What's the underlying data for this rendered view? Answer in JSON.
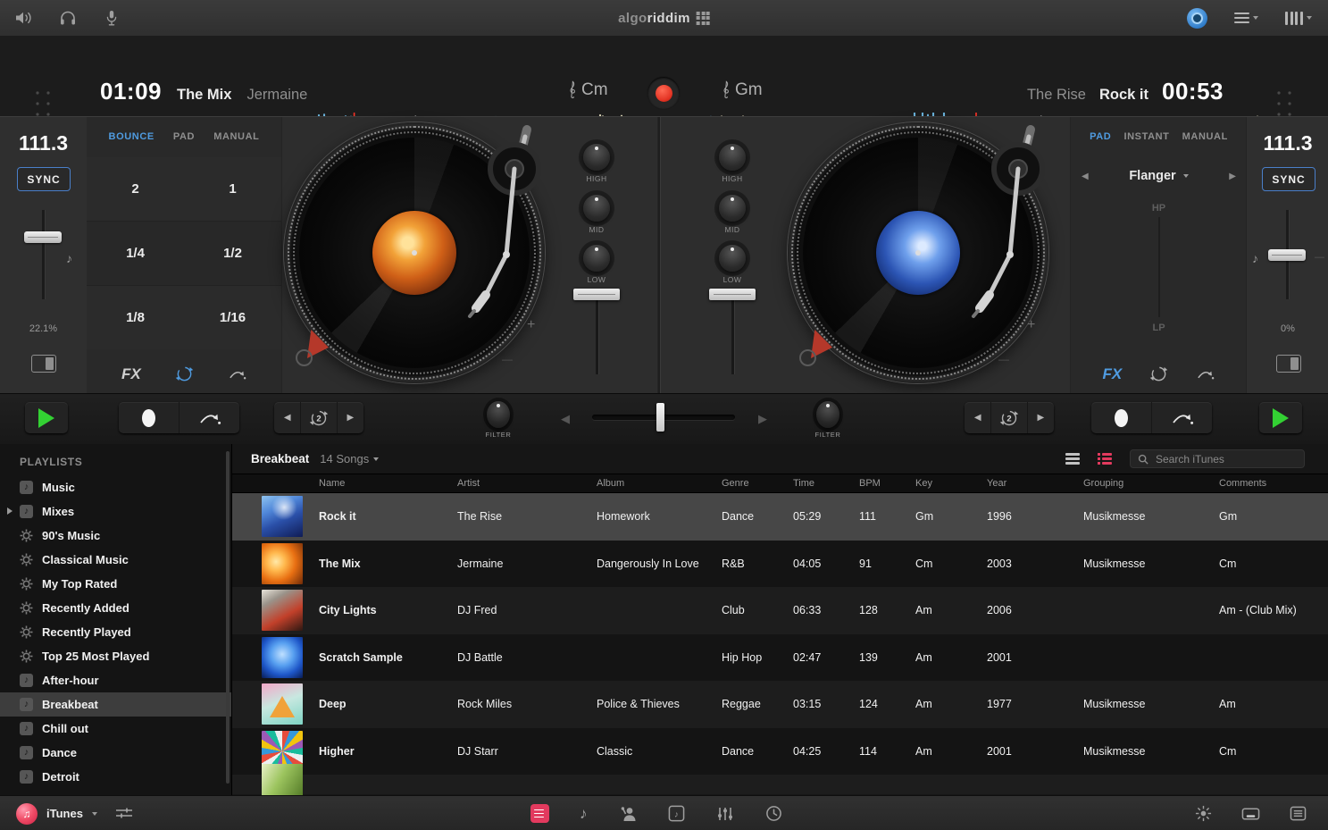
{
  "top_bar": {
    "logo_a": "algo",
    "logo_b": "riddim"
  },
  "decks": {
    "left": {
      "elapsed": "01:09",
      "title": "The Mix",
      "artist": "Jermaine",
      "key": "Cm",
      "bpm": "111.3",
      "sync_label": "SYNC",
      "pitch": "22.1%",
      "tabs": [
        "BOUNCE",
        "PAD",
        "MANUAL"
      ],
      "loop_grid": [
        "2",
        "1",
        "1/4",
        "1/2",
        "1/8",
        "1/16"
      ],
      "fx_label": "FX"
    },
    "right": {
      "remaining": "00:53",
      "title": "Rock it",
      "artist": "The Rise",
      "key": "Gm",
      "bpm": "111.3",
      "sync_label": "SYNC",
      "pitch": "0%",
      "tabs": [
        "PAD",
        "INSTANT",
        "MANUAL"
      ],
      "fx_name": "Flanger",
      "filter_hp": "HP",
      "filter_lp": "LP",
      "fx_label": "FX"
    }
  },
  "mixer": {
    "eq": [
      "HIGH",
      "MID",
      "LOW"
    ],
    "filter_label": "FILTER"
  },
  "transport": {
    "loop_beats": "2"
  },
  "waveforms": {
    "left_playhead": 0.475,
    "left_marker": 0.583,
    "right_playhead": 0.483,
    "right_marker": 0.601
  },
  "library": {
    "header": "PLAYLISTS",
    "items": [
      {
        "label": "Music"
      },
      {
        "label": "Mixes"
      },
      {
        "label": "90's Music"
      },
      {
        "label": "Classical Music"
      },
      {
        "label": "My Top Rated"
      },
      {
        "label": "Recently Added"
      },
      {
        "label": "Recently Played"
      },
      {
        "label": "Top 25 Most Played"
      },
      {
        "label": "After-hour"
      },
      {
        "label": "Breakbeat"
      },
      {
        "label": "Chill out"
      },
      {
        "label": "Dance"
      },
      {
        "label": "Detroit"
      }
    ],
    "source": {
      "label": "iTunes"
    }
  },
  "tracklist": {
    "title": "Breakbeat",
    "count": "14 Songs",
    "search_placeholder": "Search iTunes",
    "columns": [
      "Name",
      "Artist",
      "Album",
      "Genre",
      "Time",
      "BPM",
      "Key",
      "Year",
      "Grouping",
      "Comments"
    ],
    "rows": [
      {
        "name": "Rock it",
        "artist": "The Rise",
        "album": "Homework",
        "genre": "Dance",
        "time": "05:29",
        "bpm": "111",
        "key": "Gm",
        "year": "1996",
        "grouping": "Musikmesse",
        "comments": "Gm"
      },
      {
        "name": "The Mix",
        "artist": "Jermaine",
        "album": "Dangerously In Love",
        "genre": "R&B",
        "time": "04:05",
        "bpm": "91",
        "key": "Cm",
        "year": "2003",
        "grouping": "Musikmesse",
        "comments": "Cm"
      },
      {
        "name": "City Lights",
        "artist": "DJ Fred",
        "album": "",
        "genre": "Club",
        "time": "06:33",
        "bpm": "128",
        "key": "Am",
        "year": "2006",
        "grouping": "",
        "comments": "Am - (Club Mix)"
      },
      {
        "name": "Scratch Sample",
        "artist": "DJ Battle",
        "album": "",
        "genre": "Hip Hop",
        "time": "02:47",
        "bpm": "139",
        "key": "Am",
        "year": "2001",
        "grouping": "",
        "comments": ""
      },
      {
        "name": "Deep",
        "artist": "Rock Miles",
        "album": "Police & Thieves",
        "genre": "Reggae",
        "time": "03:15",
        "bpm": "124",
        "key": "Am",
        "year": "1977",
        "grouping": "Musikmesse",
        "comments": "Am"
      },
      {
        "name": "Higher",
        "artist": "DJ Starr",
        "album": "Classic",
        "genre": "Dance",
        "time": "04:25",
        "bpm": "114",
        "key": "Am",
        "year": "2001",
        "grouping": "Musikmesse",
        "comments": "Cm"
      }
    ]
  },
  "colors": {
    "accent_blue": "#4f9be0",
    "accent_pink": "#e23a5e",
    "record_red": "#e33424",
    "play_green": "#33d133"
  }
}
